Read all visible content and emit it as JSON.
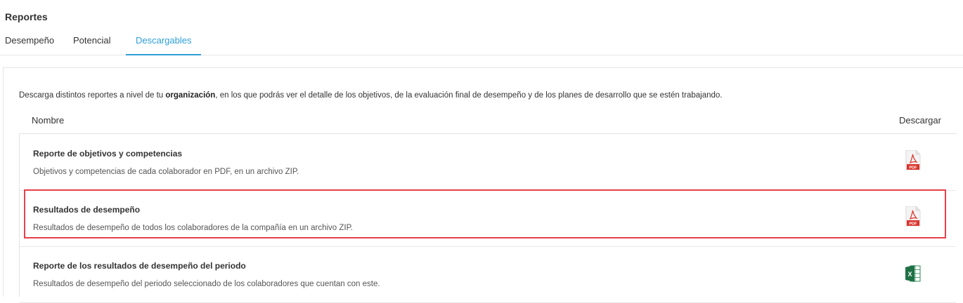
{
  "page": {
    "title": "Reportes"
  },
  "tabs": [
    {
      "label": "Desempeño"
    },
    {
      "label": "Potencial"
    },
    {
      "label": "Descargables"
    }
  ],
  "active_tab": "Descargables",
  "description": {
    "before": "Descarga distintos reportes a nivel de tu ",
    "bold": "organización",
    "after": ", en los que podrás ver el detalle de los objetivos, de la evaluación final de desempeño y de los planes de desarrollo que se estén trabajando."
  },
  "table": {
    "header_name": "Nombre",
    "header_download": "Descargar",
    "rows": [
      {
        "title": "Reporte de objetivos y competencias",
        "subtitle": "Objetivos y competencias de cada colaborador en PDF, en un archivo ZIP.",
        "file_icon": "pdf-icon",
        "file_label": "PDF"
      },
      {
        "title": "Resultados de desempeño",
        "subtitle": "Resultados de desempeño de todos los colaboradores de la compañía en un archivo ZIP.",
        "file_icon": "pdf-icon",
        "file_label": "PDF"
      },
      {
        "title": "Reporte de los resultados de desempeño del periodo",
        "subtitle": "Resultados de desempeño del periodo seleccionado de los colaboradores que cuentan con este.",
        "file_icon": "excel-icon",
        "file_label": "X"
      }
    ]
  },
  "colors": {
    "accent": "#2e9fd8",
    "highlight_border": "#e8404a",
    "pdf_red": "#d9342b",
    "excel_green": "#1e7145"
  }
}
